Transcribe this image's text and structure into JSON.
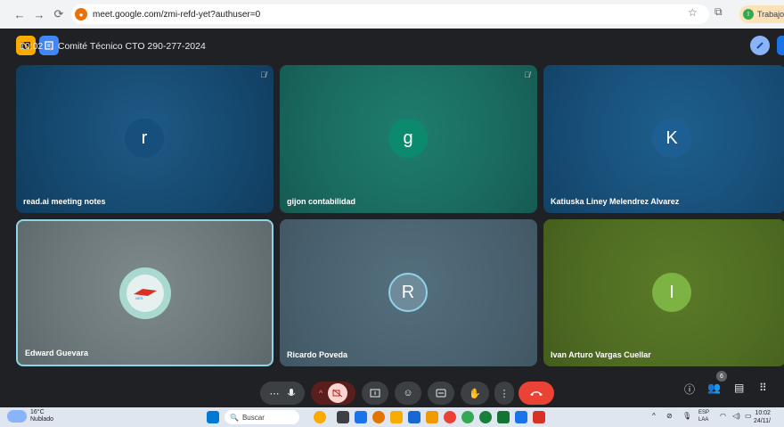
{
  "browser": {
    "url": "meet.google.com/zmi-refd-yet?authuser=0",
    "profile_label": "Trabajo",
    "profile_initial": "I"
  },
  "participants": [
    {
      "name": "read.ai meeting notes",
      "initial": "r"
    },
    {
      "name": "gijon contabilidad",
      "initial": "g"
    },
    {
      "name": "Katiuska Liney Melendrez Alvarez",
      "initial": "K"
    },
    {
      "name": "Edward Guevara",
      "initial": ""
    },
    {
      "name": "Ricardo Poveda",
      "initial": "R"
    },
    {
      "name": "Ivan Arturo Vargas Cuellar",
      "initial": "I"
    }
  ],
  "meeting": {
    "time": "10:02",
    "title": "Comité Técnico CTO 290-277-2024",
    "people_count": "6"
  },
  "taskbar": {
    "temperature": "16°C",
    "weather": "Nublado",
    "search_placeholder": "Buscar",
    "lang_top": "ESP",
    "lang_bottom": "LAA",
    "clock_time": "10:02",
    "clock_date": "24/11/"
  },
  "colors": {
    "accent_blue": "#1a73e8",
    "end_call_red": "#ea4335",
    "meet_bg": "#202124"
  }
}
